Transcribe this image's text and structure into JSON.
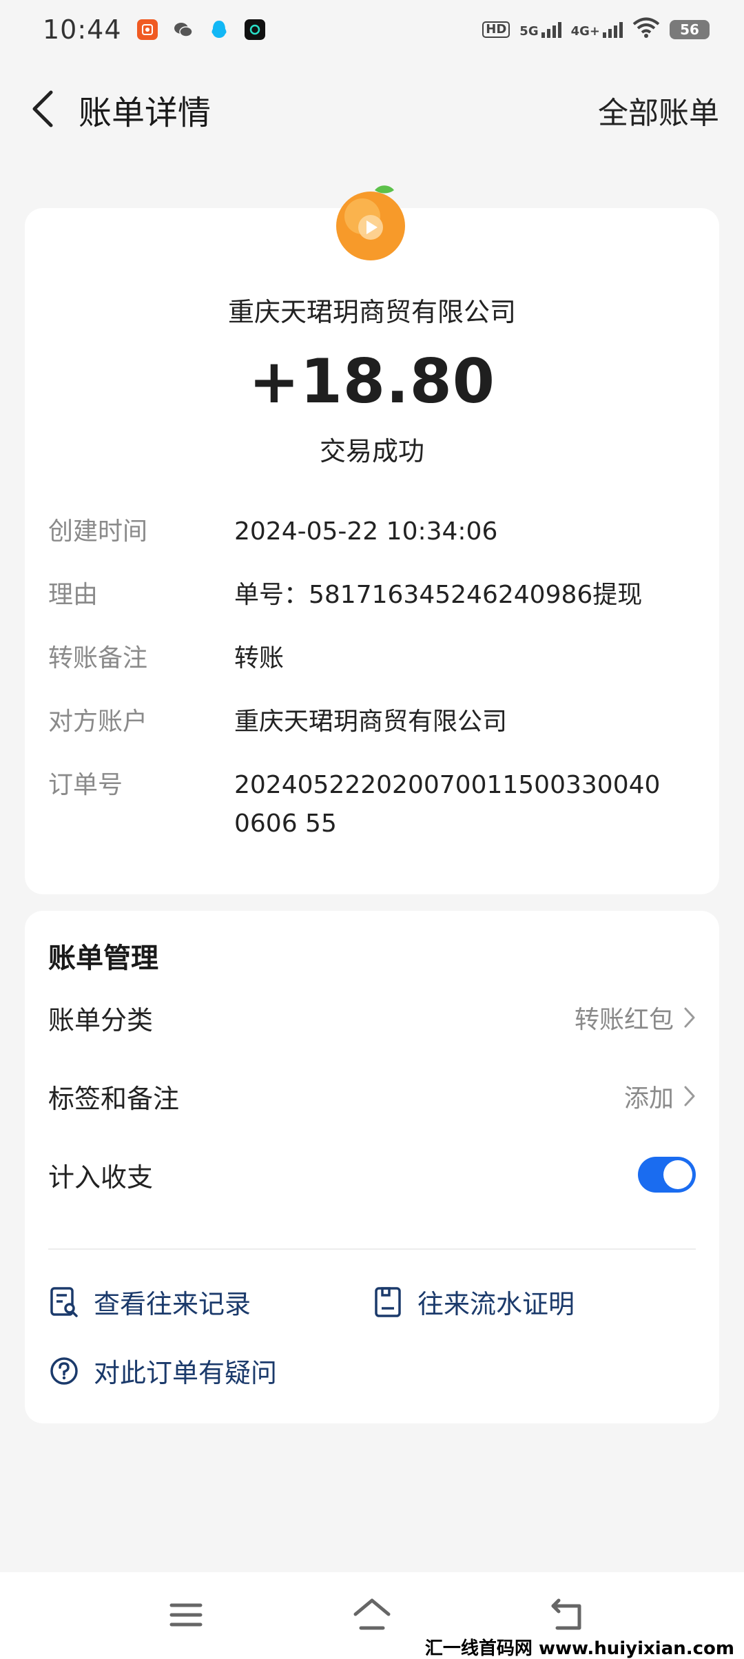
{
  "status_bar": {
    "time": "10:44",
    "hd_label": "HD",
    "sim1_label": "5G",
    "sim2_label": "4G+",
    "battery": "56"
  },
  "header": {
    "title": "账单详情",
    "all_bills": "全部账单"
  },
  "transaction": {
    "merchant": "重庆天珺玥商贸有限公司",
    "amount": "+18.80",
    "status": "交易成功",
    "details": [
      {
        "label": "创建时间",
        "value": "2024-05-22 10:34:06"
      },
      {
        "label": "理由",
        "value": "单号：581716345246240986提现"
      },
      {
        "label": "转账备注",
        "value": "转账"
      },
      {
        "label": "对方账户",
        "value": "重庆天珺玥商贸有限公司"
      },
      {
        "label": "订单号",
        "value": "2024052220200700115003300400606 55"
      }
    ]
  },
  "manage": {
    "title": "账单管理",
    "category_label": "账单分类",
    "category_value": "转账红包",
    "tags_label": "标签和备注",
    "tags_value": "添加",
    "include_label": "计入收支",
    "include_enabled": true,
    "history_link": "查看往来记录",
    "proof_link": "往来流水证明",
    "question_link": "对此订单有疑问"
  },
  "watermark": "汇一线首码网 www.huiyixian.com",
  "colors": {
    "accent": "#1a6cf0",
    "link": "#1b3a6b",
    "background": "#f5f5f5"
  }
}
